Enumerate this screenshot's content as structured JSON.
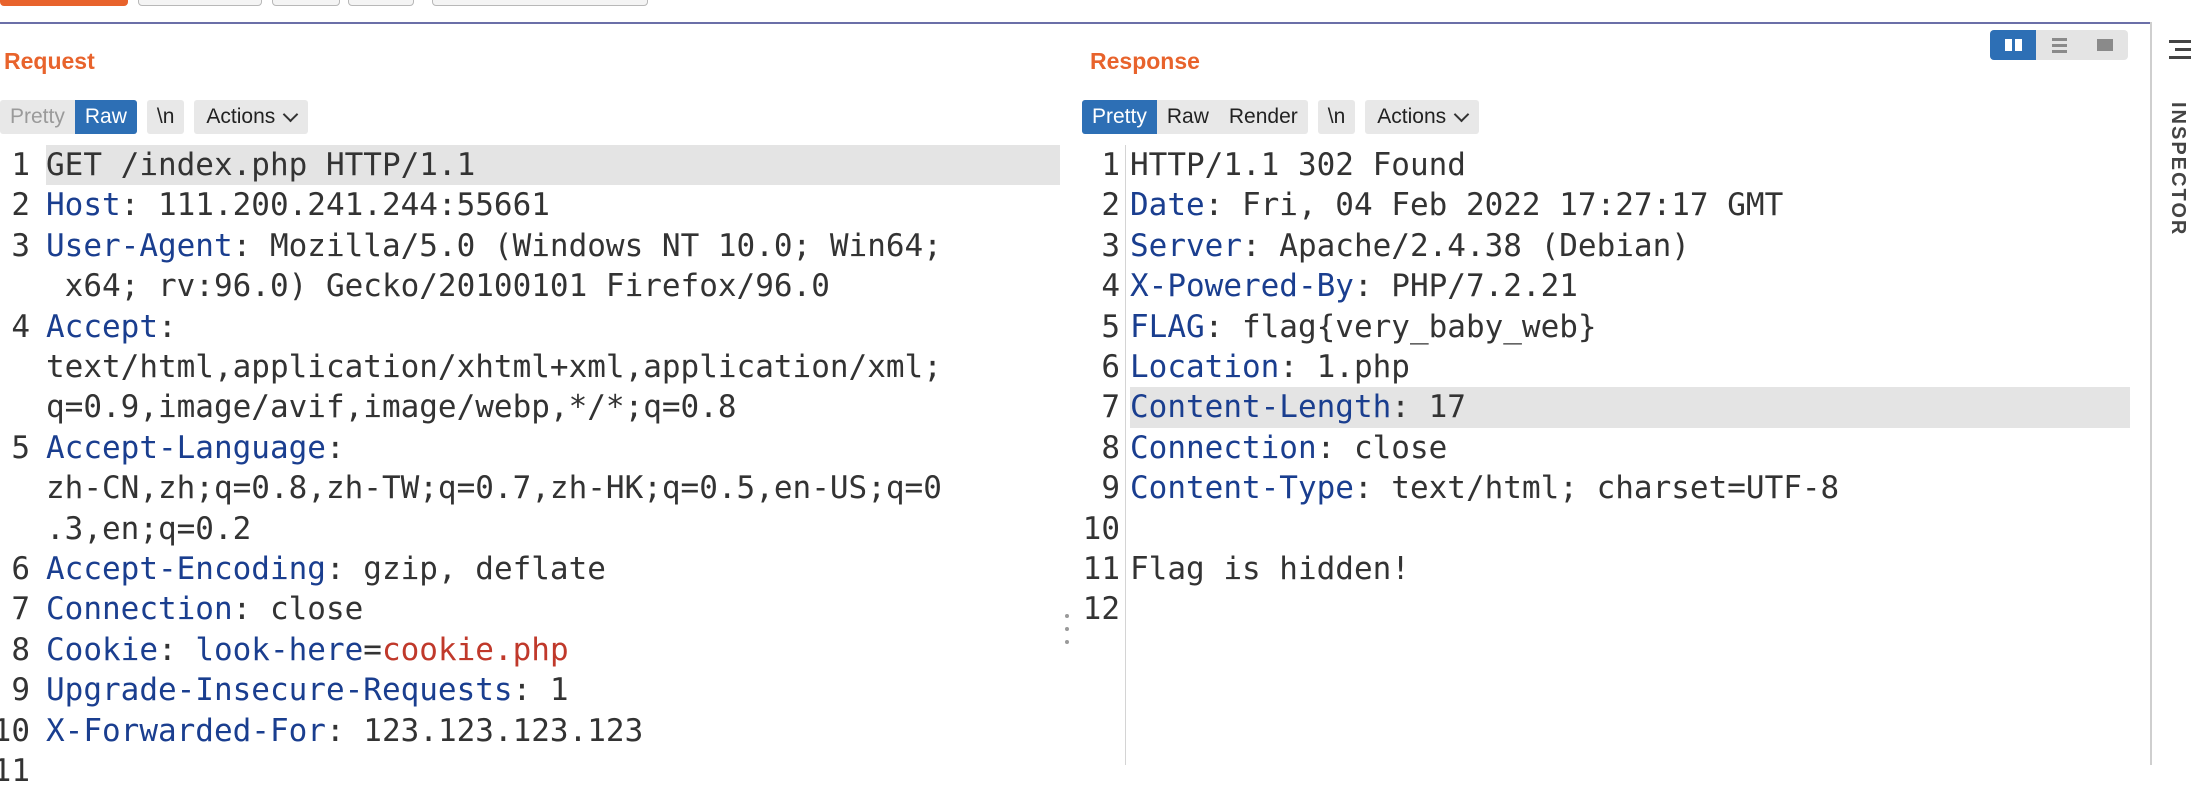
{
  "request": {
    "title": "Request",
    "view_modes": [
      "Pretty",
      "Raw"
    ],
    "active_view": "Raw",
    "newline_label": "\\n",
    "actions_label": "Actions",
    "line_numbers": [
      "1",
      "2",
      "3",
      "",
      "4",
      "",
      "",
      "5",
      "",
      "",
      "6",
      "7",
      "8",
      "9",
      "10",
      "11"
    ],
    "lines": {
      "l1": "GET /index.php HTTP/1.1",
      "l2_name": "Host",
      "l2_value": ": 111.200.241.244:55661",
      "l3_name": "User-Agent",
      "l3_value": ": Mozilla/5.0 (Windows NT 10.0; Win64;",
      "l3_wrap": " x64; rv:96.0) Gecko/20100101 Firefox/96.0",
      "l4_name": "Accept",
      "l4_value": ":",
      "l4_wrap1": "text/html,application/xhtml+xml,application/xml;",
      "l4_wrap2": "q=0.9,image/avif,image/webp,*/*;q=0.8",
      "l5_name": "Accept-Language",
      "l5_value": ":",
      "l5_wrap1": "zh-CN,zh;q=0.8,zh-TW;q=0.7,zh-HK;q=0.5,en-US;q=0",
      "l5_wrap2": ".3,en;q=0.2",
      "l6_name": "Accept-Encoding",
      "l6_value": ": gzip, deflate",
      "l7_name": "Connection",
      "l7_value": ": close",
      "l8_name": "Cookie",
      "l8_sep": ": ",
      "l8_cookie_name": "look-here",
      "l8_eq": "=",
      "l8_cookie_value": "cookie.php",
      "l9_name": "Upgrade-Insecure-Requests",
      "l9_value": ": 1",
      "l10_name": "X-Forwarded-For",
      "l10_value": ": 123.123.123.123"
    }
  },
  "response": {
    "title": "Response",
    "view_modes": [
      "Pretty",
      "Raw",
      "Render"
    ],
    "active_view": "Pretty",
    "newline_label": "\\n",
    "actions_label": "Actions",
    "line_numbers": [
      "1",
      "2",
      "3",
      "4",
      "5",
      "6",
      "7",
      "8",
      "9",
      "10",
      "11",
      "12"
    ],
    "lines": {
      "l1": "HTTP/1.1 302 Found",
      "l2_name": "Date",
      "l2_value": ": Fri, 04 Feb 2022 17:27:17 GMT",
      "l3_name": "Server",
      "l3_value": ": Apache/2.4.38 (Debian)",
      "l4_name": "X-Powered-By",
      "l4_value": ": PHP/7.2.21",
      "l5_name": "FLAG",
      "l5_value": ": flag{very_baby_web}",
      "l6_name": "Location",
      "l6_value": ": 1.php",
      "l7_name": "Content-Length",
      "l7_value": ": 17",
      "l8_name": "Connection",
      "l8_value": ": close",
      "l9_name": "Content-Type",
      "l9_value": ": text/html; charset=UTF-8",
      "l10": "",
      "l11": "Flag is hidden!",
      "l12": ""
    }
  },
  "layout_toggle": {
    "options": [
      "columns-icon",
      "rows-icon",
      "single-pane-icon"
    ],
    "active": "columns-icon"
  },
  "sidebar": {
    "inspector_label": "INSPECTOR"
  },
  "colors": {
    "accent": "#e8632c",
    "active_button": "#2d6fb5",
    "header_name": "#1a3e8f",
    "cookie_value": "#c0392b"
  }
}
